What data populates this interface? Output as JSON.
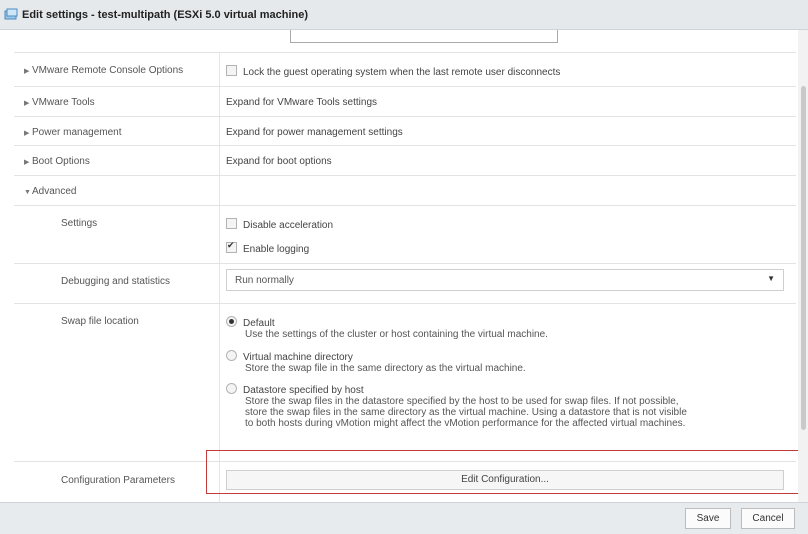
{
  "window": {
    "title": "Edit settings - test-multipath (ESXi 5.0 virtual machine)",
    "icon": "vm-icon"
  },
  "rows": {
    "remote_console": {
      "label": "VMware Remote Console Options",
      "checkbox_label": "Lock the guest operating system when the last remote user disconnects",
      "checked": false
    },
    "tools": {
      "label": "VMware Tools",
      "value": "Expand for VMware Tools settings"
    },
    "power": {
      "label": "Power management",
      "value": "Expand for power management settings"
    },
    "boot": {
      "label": "Boot Options",
      "value": "Expand for boot options"
    },
    "advanced": {
      "label": "Advanced"
    },
    "settings": {
      "label": "Settings",
      "disable_accel": "Disable acceleration",
      "enable_logging": "Enable logging"
    },
    "debugging": {
      "label": "Debugging and statistics",
      "selected": "Run normally"
    },
    "swap": {
      "label": "Swap file location",
      "options": [
        {
          "title": "Default",
          "desc": "Use the settings of the cluster or host containing the virtual machine."
        },
        {
          "title": "Virtual machine directory",
          "desc": "Store the swap file in the same directory as the virtual machine."
        },
        {
          "title": "Datastore specified by host",
          "desc": "Store the swap files in the datastore specified by the host to be used for swap files. If not possible, store the swap files in the same directory as the virtual machine. Using a datastore that is not visible to both hosts during vMotion might affect the vMotion performance for the affected virtual machines."
        }
      ]
    },
    "config": {
      "label": "Configuration Parameters",
      "button": "Edit Configuration..."
    }
  },
  "footer": {
    "save": "Save",
    "cancel": "Cancel"
  },
  "colors": {
    "highlight": "#c43a3a",
    "titlebar": "#e6e9ec"
  }
}
